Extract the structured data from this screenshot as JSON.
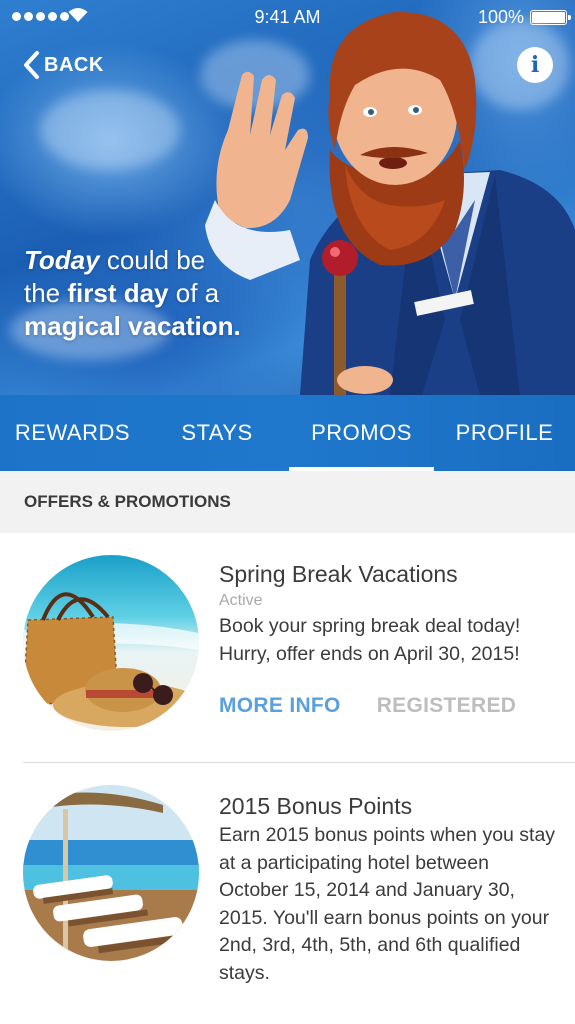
{
  "status_bar": {
    "time": "9:41 AM",
    "battery": "100%"
  },
  "hero": {
    "back_label": "BACK",
    "info_label": "i",
    "tagline": {
      "part1_italic": "Today",
      "part2": " could be",
      "part3": "the ",
      "part4_bold": "first day",
      "part5": " of a",
      "part6_bold": "magical vacation."
    }
  },
  "tabs": [
    {
      "label": "REWARDS",
      "active": false
    },
    {
      "label": "STAYS",
      "active": false
    },
    {
      "label": "PROMOS",
      "active": true
    },
    {
      "label": "PROFILE",
      "active": false
    }
  ],
  "section": {
    "title": "OFFERS & PROMOTIONS"
  },
  "promos": [
    {
      "title": "Spring Break Vacations",
      "status": "Active",
      "description": "Book your spring break deal today! Hurry, offer ends on April 30, 2015!",
      "more_info_label": "MORE INFO",
      "registered_label": "REGISTERED"
    },
    {
      "title": "2015 Bonus Points",
      "description": "Earn 2015 bonus points when you stay at a participating hotel between October 15, 2014 and January 30, 2015. You'll earn bonus points on your 2nd, 3rd, 4th, 5th, and 6th qualified stays."
    }
  ],
  "colors": {
    "brand_blue": "#1f78cc",
    "link_blue": "#5aa0de",
    "disabled_gray": "#bdbdbd"
  }
}
